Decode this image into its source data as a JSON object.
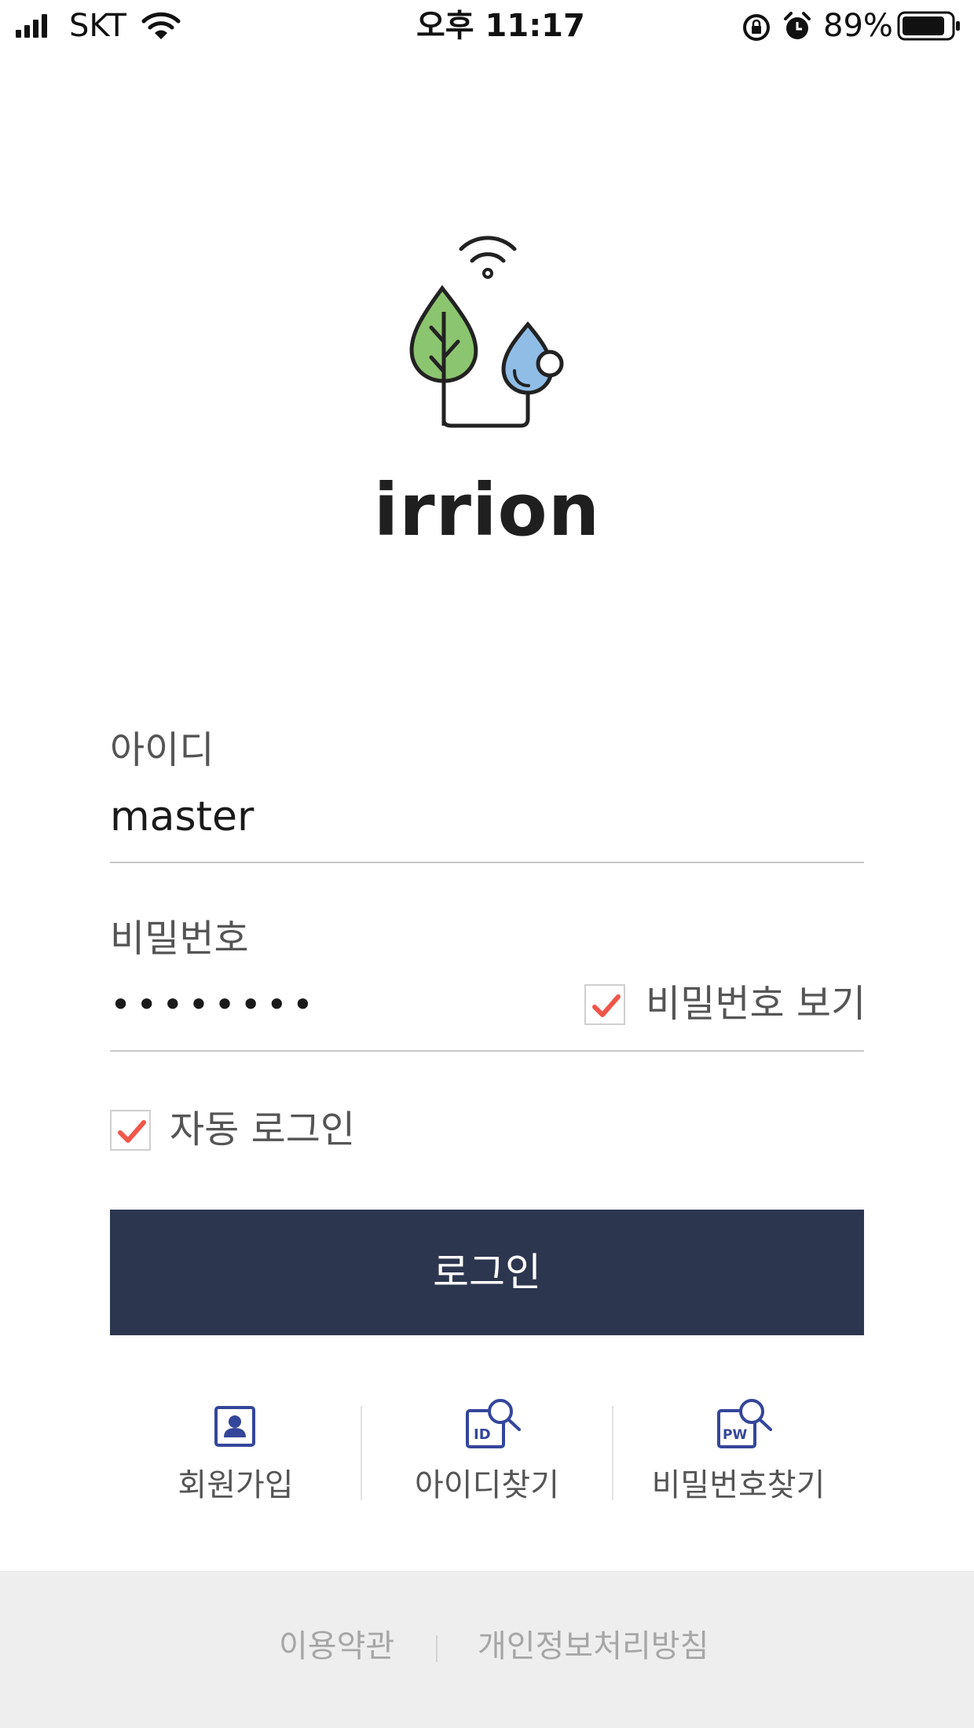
{
  "status_bar": {
    "carrier": "SKT",
    "time": "오후 11:17",
    "battery_percent": "89%",
    "battery_level": 0.89
  },
  "brand": {
    "name": "irrion"
  },
  "form": {
    "id_label": "아이디",
    "id_value": "master",
    "password_label": "비밀번호",
    "password_value": "••••••••",
    "show_password_label": "비밀번호 보기",
    "show_password_checked": true,
    "auto_login_label": "자동 로그인",
    "auto_login_checked": true,
    "login_button": "로그인"
  },
  "links": [
    {
      "label": "회원가입",
      "icon": "user-card-icon"
    },
    {
      "label": "아이디찾기",
      "icon": "id-search-icon",
      "icon_text": "ID"
    },
    {
      "label": "비밀번호찾기",
      "icon": "pw-search-icon",
      "icon_text": "PW"
    }
  ],
  "footer": {
    "terms": "이용약관",
    "privacy": "개인정보처리방침"
  },
  "colors": {
    "primary": "#2d364f",
    "check": "#f0564a",
    "leaf": "#8cc56f",
    "drop": "#8fbde6",
    "icon_blue": "#34469a"
  }
}
